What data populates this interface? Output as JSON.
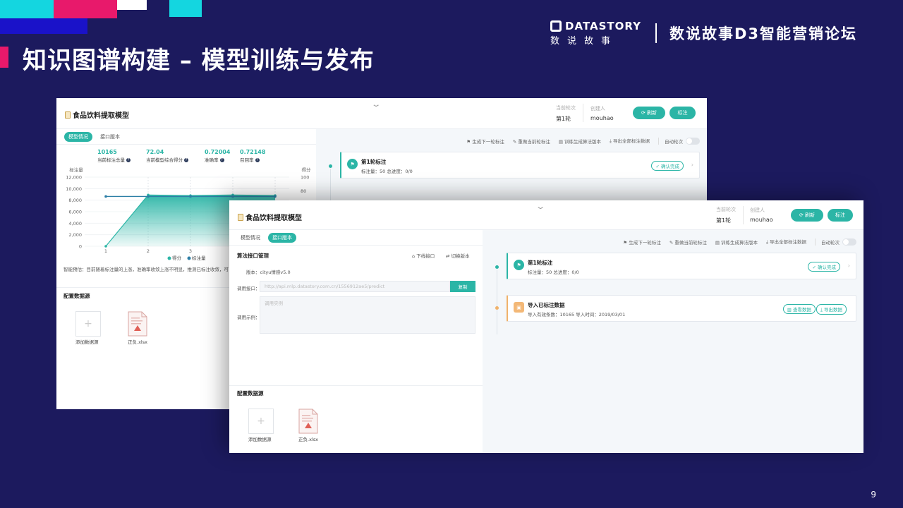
{
  "slide": {
    "title": "知识图谱构建 – 模型训练与发布",
    "page_number": "9",
    "brand_logo": "DATASTORY",
    "brand_logo_cn": "数说故事",
    "brand_forum": "数说故事D3智能营销论坛"
  },
  "back_window": {
    "title": "食品饮料提取模型",
    "round_label": "当前轮次",
    "round_value": "第1轮",
    "creator_label": "创建人",
    "creator_value": "mouhao",
    "refresh_button": "刷新",
    "label_button": "标注",
    "tabs": [
      "模型情况",
      "接口版本"
    ],
    "stats": [
      {
        "value": "10165",
        "label": "当前标注总量"
      },
      {
        "value": "72.04",
        "label": "当前模型综合得分"
      },
      {
        "value": "0.72004",
        "label": "准确率"
      },
      {
        "value": "0.72148",
        "label": "召回率"
      }
    ],
    "note": "智能预估：目前随着标注量的上涨，准确率收敛上涨不明显，推测已标注收敛，可",
    "datasource_title": "配置数据源",
    "add_datasource": "添加数据源",
    "file_name": "正负.xlsx",
    "toolbar": [
      "生成下一轮标注",
      "重做当前轮标注",
      "训练生成算法版本",
      "导出全部标注数据"
    ],
    "auto_round": "自动轮次",
    "card": {
      "title": "第1轮标注",
      "sub": "标注量：50    总进度：0/0",
      "confirm": "确认完成"
    }
  },
  "chart_data": {
    "type": "line",
    "title": "",
    "ylabel": "标注量",
    "y2label": "得分",
    "x": [
      1,
      2,
      3,
      4,
      5
    ],
    "xticks": [
      "1",
      "2",
      "3"
    ],
    "yticks": [
      "0",
      "2,000",
      "4,000",
      "6,000",
      "8,000",
      "10,000",
      "12,000"
    ],
    "y2ticks": [
      "100",
      "80"
    ],
    "ylim": [
      0,
      12000
    ],
    "y2lim": [
      0,
      100
    ],
    "series": [
      {
        "name": "得分",
        "axis": "right",
        "values": [
          72,
          72,
          72,
          72,
          72
        ]
      },
      {
        "name": "标注量",
        "axis": "left",
        "values": [
          0,
          8900,
          8800,
          8900,
          8800
        ]
      }
    ],
    "legend": "bottom",
    "grid": true
  },
  "front_window": {
    "title": "食品饮料提取模型",
    "round_label": "当前轮次",
    "round_value": "第1轮",
    "creator_label": "创建人",
    "creator_value": "mouhao",
    "refresh_button": "刷新",
    "label_button": "标注",
    "tabs": [
      "模型情况",
      "接口版本"
    ],
    "api_section_title": "算法接口管理",
    "offline_api": "下线接口",
    "switch_version": "切换版本",
    "version_label": "版本：",
    "version_value": "cityu情感v5.0",
    "call_api_label": "调用接口：",
    "call_api_placeholder": "http://api.mlp.datastory.com.cn/1556912ae5/predict",
    "copy_button": "复制",
    "call_example_label": "调用示例：",
    "call_example_placeholder": "调用实例",
    "datasource_title": "配置数据源",
    "add_datasource": "添加数据源",
    "file_name": "正负.xlsx",
    "toolbar": [
      "生成下一轮标注",
      "重做当前轮标注",
      "训练生成算法版本",
      "导出全部标注数据"
    ],
    "auto_round": "自动轮次",
    "card1": {
      "title": "第1轮标注",
      "sub": "标注量：50    总进度：0/0",
      "confirm": "确认完成"
    },
    "card2": {
      "title": "导入已标注数据",
      "sub": "导入有效条数：10165    导入时间：2019/03/01",
      "view": "查看数据",
      "export": "导出数据"
    }
  }
}
